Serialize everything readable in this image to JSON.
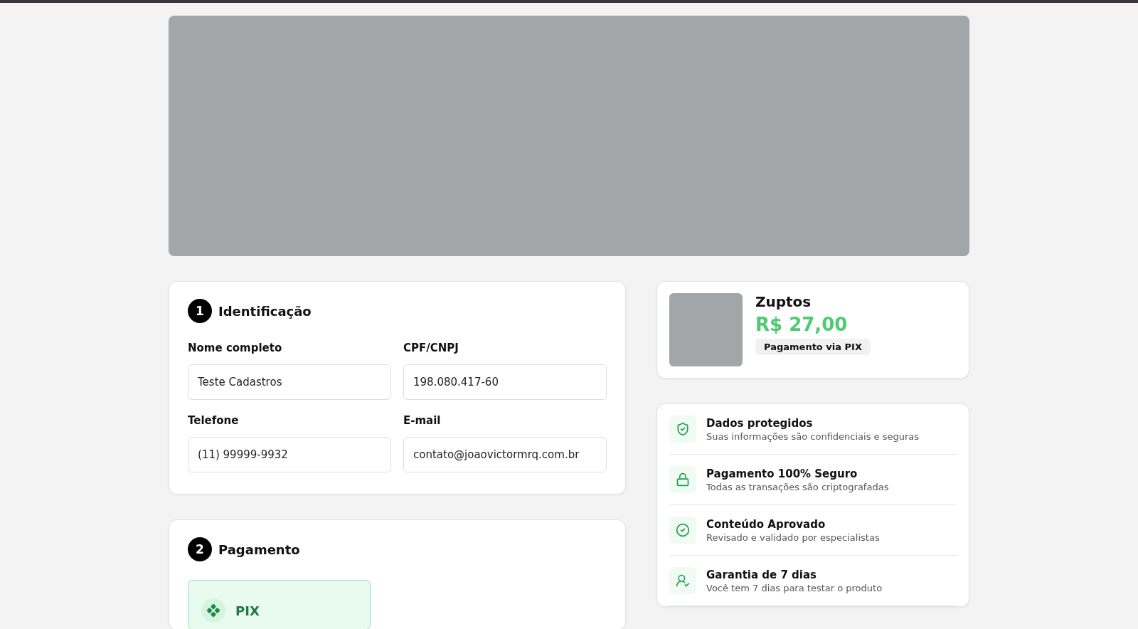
{
  "identification": {
    "step": "1",
    "title": "Identificação",
    "fields": [
      {
        "label": "Nome completo",
        "value": "Teste Cadastros"
      },
      {
        "label": "CPF/CNPJ",
        "value": "198.080.417-60"
      },
      {
        "label": "Telefone",
        "value": "(11) 99999-9932"
      },
      {
        "label": "E-mail",
        "value": "contato@joaovictormrq.com.br"
      }
    ]
  },
  "payment": {
    "step": "2",
    "title": "Pagamento",
    "methods": [
      {
        "label": "PIX",
        "selected": true
      }
    ]
  },
  "product": {
    "name": "Zuptos",
    "price": "R$ 27,00",
    "badge": "Pagamento via PIX"
  },
  "features": [
    {
      "title": "Dados protegidos",
      "subtitle": "Suas informações são confidenciais e seguras"
    },
    {
      "title": "Pagamento 100% Seguro",
      "subtitle": "Todas as transações são criptografadas"
    },
    {
      "title": "Conteúdo Aprovado",
      "subtitle": "Revisado e validado por especialistas"
    },
    {
      "title": "Garantia de 7 dias",
      "subtitle": "Você tem 7 dias para testar o produto"
    }
  ]
}
